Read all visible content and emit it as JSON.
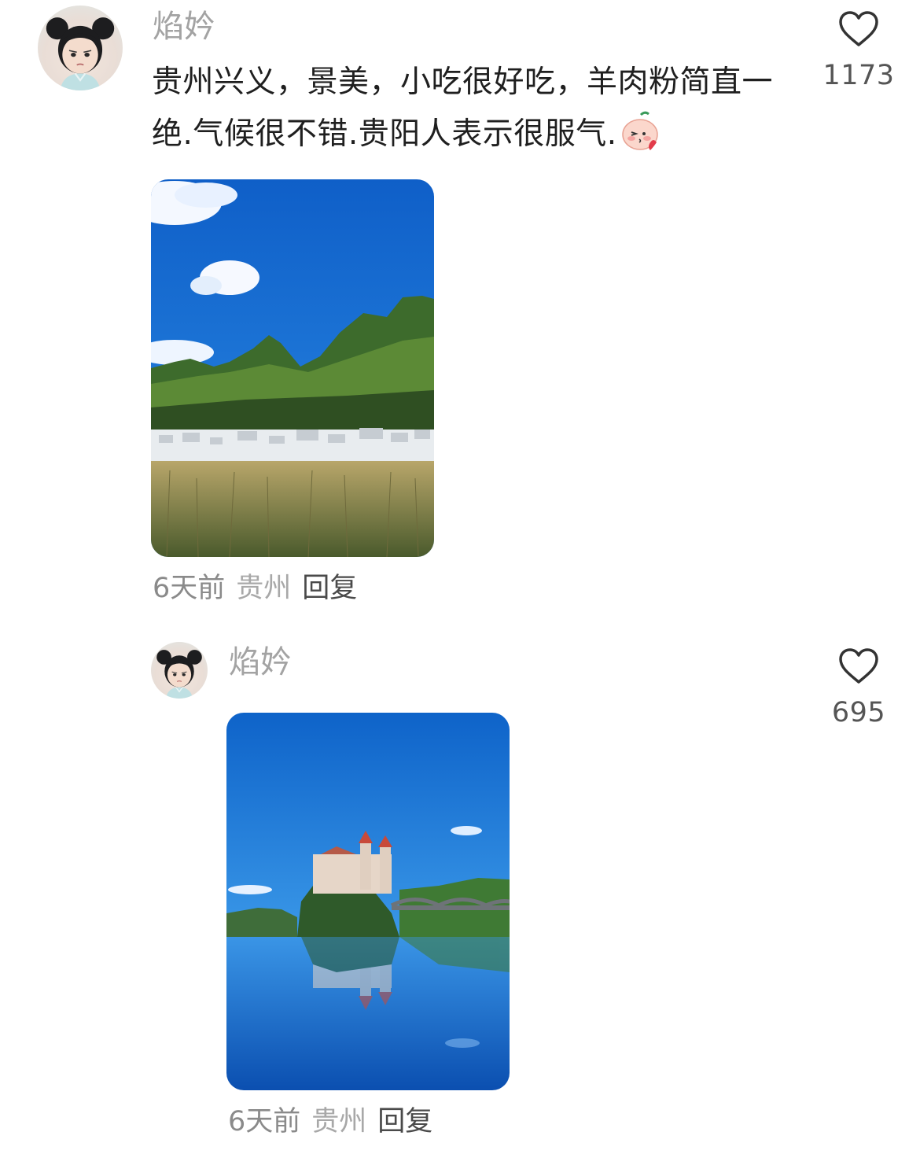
{
  "comments": [
    {
      "username": "焰妗",
      "text": "贵州兴义，景美，小吃很好吃，羊肉粉简直一绝.气候很不错.贵阳人表示很服气.",
      "emoji": "blush-kiss-emoji",
      "likes": "1173",
      "time": "6天前",
      "location": "贵州",
      "reply_label": "回复",
      "photo": "karst-mountain-village-photo"
    },
    {
      "username": "焰妗",
      "likes": "695",
      "time": "6天前",
      "location": "贵州",
      "reply_label": "回复",
      "photo": "lake-castle-reflection-photo"
    }
  ],
  "icons": {
    "like": "heart-outline-icon"
  },
  "colors": {
    "username": "#a3a3a3",
    "text": "#1f1f1f",
    "meta": "#8a8a8a",
    "like_icon": "#333333"
  }
}
